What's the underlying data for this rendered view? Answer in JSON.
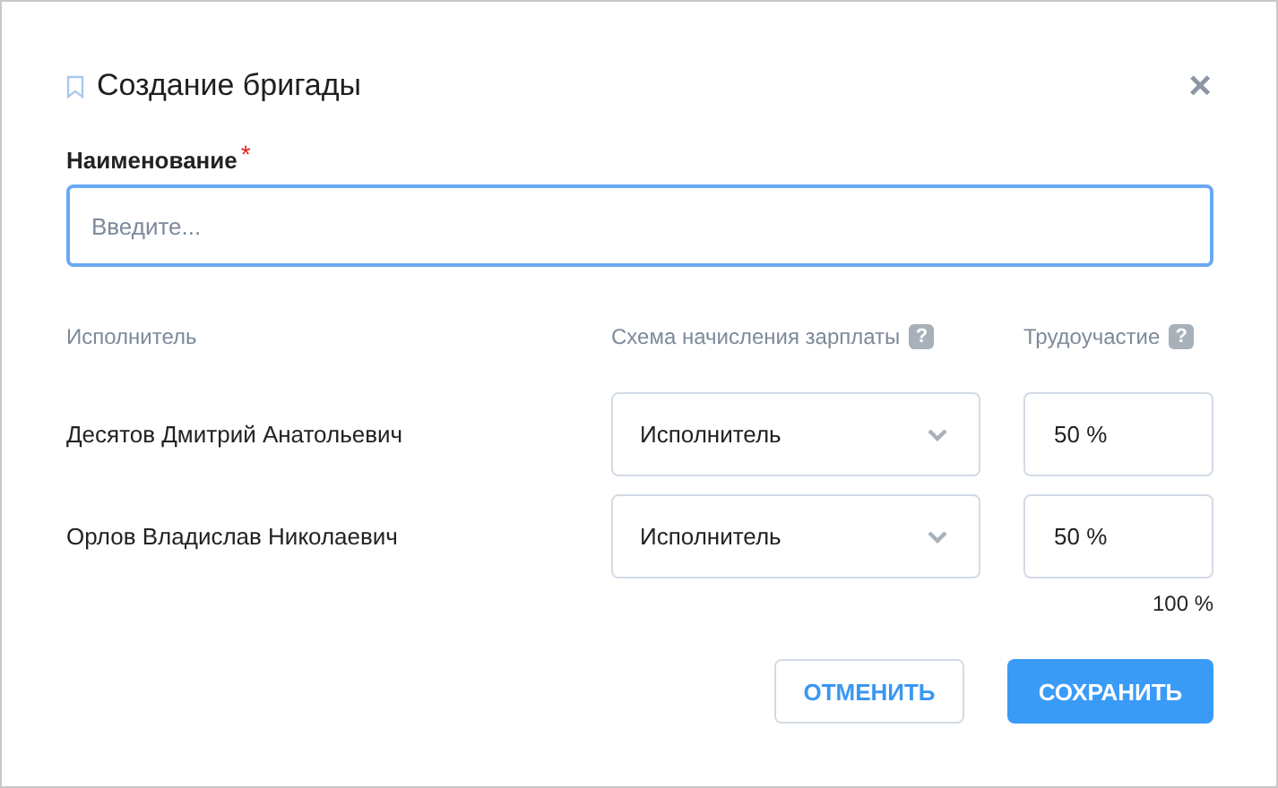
{
  "dialog": {
    "title": "Создание бригады",
    "close": "×"
  },
  "name_field": {
    "label": "Наименование",
    "required_mark": "*",
    "placeholder": "Введите..."
  },
  "columns": [
    {
      "label": "Исполнитель"
    },
    {
      "label": "Схема начисления зарплаты",
      "help": "?"
    },
    {
      "label": "Трудоучастие",
      "help": "?"
    }
  ],
  "rows": [
    {
      "name": "Десятов Дмитрий Анатольевич",
      "scheme": "Исполнитель",
      "share": "50 %"
    },
    {
      "name": "Орлов Владислав Николаевич",
      "scheme": "Исполнитель",
      "share": "50 %"
    }
  ],
  "total": "100 %",
  "buttons": [
    {
      "label": "ОТМЕНИТЬ",
      "kind": "secondary"
    },
    {
      "label": "СОХРАНИТЬ",
      "kind": "primary"
    }
  ]
}
